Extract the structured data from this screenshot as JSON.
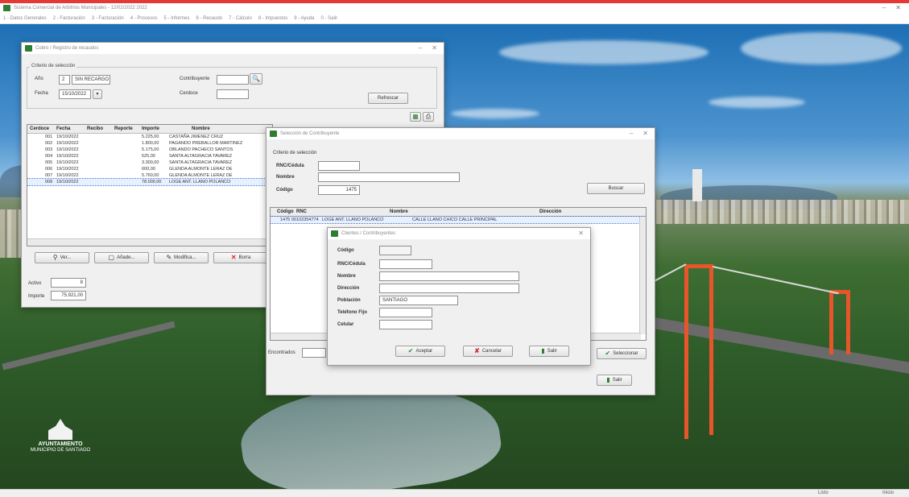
{
  "app": {
    "title": "Sistema Comercial de Arbitrios Municipales - 12/02/2022 2022",
    "menu": [
      "1 - Datos Generales",
      "2 - Facturación",
      "3 - Facturación",
      "4 - Procesos",
      "5 - Informes",
      "6 - Recaudo",
      "7 - Cálculo",
      "8 - Impuestos",
      "9 - Ayuda",
      "0 - Salir"
    ],
    "controls": {
      "minimize": "–",
      "close": "✕"
    }
  },
  "desktop": {
    "logo_text_1": "AYUNTAMIENTO",
    "logo_text_2": "MUNICIPIO DE SANTIAGO"
  },
  "win_registro": {
    "title": "Cobro / Registro de recaudos",
    "group_title": "Criterio de selección",
    "label_ano": "Año",
    "value_ano": "2",
    "value_ano_desc": "SIN RECARGO",
    "label_contribuyente": "Contribuyente",
    "label_fecha": "Fecha",
    "value_fecha": "15/10/2022",
    "label_cerdoce": "Cerdoce",
    "refrescar_label": "Refrescar",
    "columns": [
      "Cerdoce",
      "Fecha",
      "Recibo",
      "Reporte",
      "Importe",
      "Nombre"
    ],
    "rows": [
      [
        "001",
        "19/10/2022",
        "",
        "",
        "5.225,00",
        "CASTAÑA JIMENEZ CRUZ"
      ],
      [
        "002",
        "19/10/2022",
        "",
        "",
        "1.800,00",
        "PAGANDO PREBALLOR MARTINEZ"
      ],
      [
        "003",
        "19/10/2022",
        "",
        "",
        "5.175,00",
        "OBLANDO PACHECO SANTOS"
      ],
      [
        "004",
        "19/10/2022",
        "",
        "",
        "525,00",
        "SANTA ALTAGRACIA TAVAREZ"
      ],
      [
        "005",
        "19/10/2022",
        "",
        "",
        "3.300,00",
        "SANTA ALTAGRACIA TAVAREZ"
      ],
      [
        "006",
        "19/10/2022",
        "",
        "",
        "600,00",
        "GLENDA ALMONTE LERAZ DE"
      ],
      [
        "007",
        "19/10/2022",
        "",
        "",
        "5.760,00",
        "GLENDA ALMONTE LERAZ DE"
      ],
      [
        "008",
        "19/10/2022",
        "",
        "",
        "78.000,00",
        "LOGE ANT. LLANO POLANCO"
      ]
    ],
    "btn_ver": "Ver...",
    "btn_anade": "Añade...",
    "btn_modifica": "Modifica...",
    "btn_borra": "Borra",
    "label_activo": "Activo",
    "value_activo": "8",
    "label_importe": "Importe",
    "value_importe": "75.921,00"
  },
  "win_seleccion": {
    "title": "Selección de Contribuyente",
    "group_title": "Criterio de selección",
    "label_rnc": "RNC/Cédula",
    "label_nombre": "Nombre",
    "label_codigo": "Código",
    "value_codigo": "1475",
    "btn_buscar": "Buscar",
    "columns": [
      "Código",
      "RNC",
      "Nombre",
      "Dirección"
    ],
    "rows": [
      [
        "1475",
        "00102354774",
        "LOGE ANT. LLANO POLANCO",
        "CALLE LLANO CHICO CALLE PRINCIPAL"
      ]
    ],
    "label_encontrados": "Encontrados",
    "btn_seleccionar": "Seleccionar",
    "btn_salir": "Salir"
  },
  "win_clientes": {
    "title": "Clientes / Contribuyentes",
    "label_codigo": "Código",
    "label_rnc": "RNC/Cédula",
    "label_nombre": "Nombre",
    "label_direccion": "Dirección",
    "label_poblacion": "Población",
    "value_poblacion": "SANTIAGO",
    "label_telefono": "Teléfono Fijo",
    "label_celular": "Celular",
    "btn_aceptar": "Aceptar",
    "btn_cancelar": "Cancelar",
    "btn_salir": "Salir"
  },
  "statusbar": {
    "left": "Listo",
    "right": "Inicio"
  },
  "colors": {
    "accent_red": "#e53935",
    "app_green": "#2e7d32",
    "bridge_orange": "#e8552a"
  }
}
